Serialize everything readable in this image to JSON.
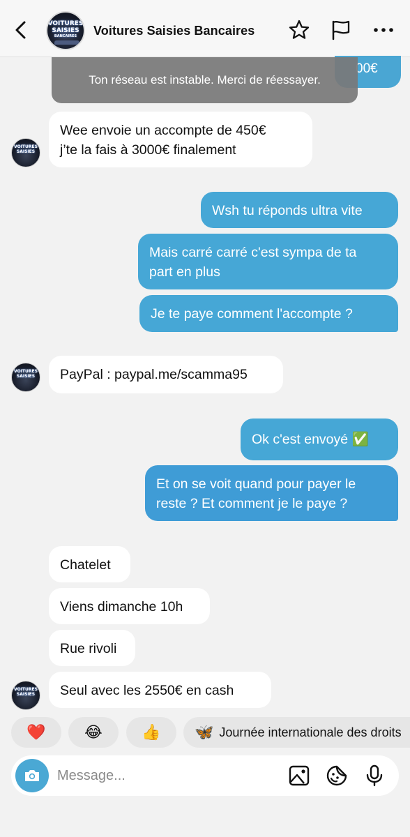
{
  "header": {
    "title": "Voitures Saisies Bancaires",
    "logo_line1": "VOITURES",
    "logo_line2": "SAISIES",
    "logo_line3": "BANCAIRES",
    "icons": [
      "back-arrow-icon",
      "star-icon",
      "flag-icon",
      "more-icon"
    ]
  },
  "toast": {
    "text": "Ton réseau est instable. Merci de réessayer.",
    "peek_text": "00€"
  },
  "messages": [
    {
      "side": "in",
      "lines": [
        "Wee envoie un accompte de 450€",
        "j’te la fais à 3000€ finalement"
      ]
    },
    {
      "side": "out",
      "lines": [
        "Wsh tu réponds ultra vite"
      ]
    },
    {
      "side": "out",
      "lines": [
        "Mais carré carré c'est sympa de ta",
        "part en plus"
      ]
    },
    {
      "side": "out",
      "lines": [
        "Je te paye comment l'accompte ?"
      ]
    },
    {
      "side": "in",
      "lines": [
        "PayPal : paypal.me/scamma95"
      ]
    },
    {
      "side": "out",
      "lines": [
        "Ok c'est envoyé ✅"
      ]
    },
    {
      "side": "out",
      "lines": [
        "Et on se voit quand pour payer le",
        "reste ? Et comment je le paye ?"
      ]
    },
    {
      "side": "in",
      "lines": [
        "Chatelet"
      ]
    },
    {
      "side": "in",
      "lines": [
        "Viens dimanche 10h"
      ]
    },
    {
      "side": "in",
      "lines": [
        "Rue rivoli"
      ]
    },
    {
      "side": "in",
      "lines": [
        "Seul avec les 2550€ en cash"
      ]
    }
  ],
  "reactions": {
    "heart": "❤️",
    "laugh": "😂",
    "thumbs": "👍",
    "butterfly": "🦋",
    "event_label": "Journée internationale des droits"
  },
  "composer": {
    "placeholder": "Message..."
  },
  "colors": {
    "outgoing_bubble": "#46a7d6",
    "incoming_bubble": "#ffffff",
    "camera_button": "#4aa8d4"
  }
}
